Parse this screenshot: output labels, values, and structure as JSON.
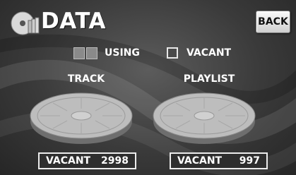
{
  "header": {
    "title": "DATA",
    "back_label": "BACK"
  },
  "legend": {
    "using_label": "USING",
    "vacant_label": "VACANT"
  },
  "track": {
    "label": "TRACK",
    "status_label": "VACANT",
    "count": "2998"
  },
  "playlist": {
    "label": "PLAYLIST",
    "status_label": "VACANT",
    "count": "997"
  },
  "icons": {
    "header": "disc-stack-icon"
  },
  "colors": {
    "background": "#3a3a3a",
    "button": "#e6e6e6",
    "using_swatch": "#8a8a8a",
    "text": "#ffffff"
  }
}
